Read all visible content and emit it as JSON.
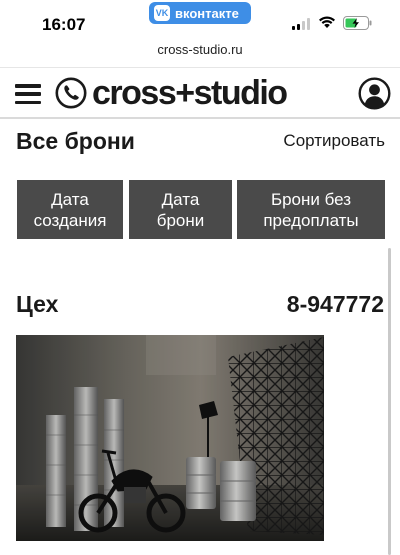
{
  "status_bar": {
    "time": "16:07",
    "app_pill": "вконтакте",
    "app_pill_logo": "VK",
    "accent_color": "#3e8ee6"
  },
  "browser": {
    "url": "cross-studio.ru"
  },
  "header": {
    "logo_text": "cross+studio",
    "icons": [
      "menu-icon",
      "phone-icon",
      "user-icon"
    ]
  },
  "page": {
    "title": "Все брони",
    "sort_label": "Сортировать"
  },
  "filters": [
    {
      "label": "Дата\nсоздания"
    },
    {
      "label": "Дата\nброни"
    },
    {
      "label": "Брони без\nпредоплаты"
    }
  ],
  "booking": {
    "studio_name": "Цех",
    "phone": "8-947772",
    "photo_description_icon": "studio-photo"
  },
  "colors": {
    "button_bg": "#4a4a4a",
    "text": "#1a1a1a"
  }
}
